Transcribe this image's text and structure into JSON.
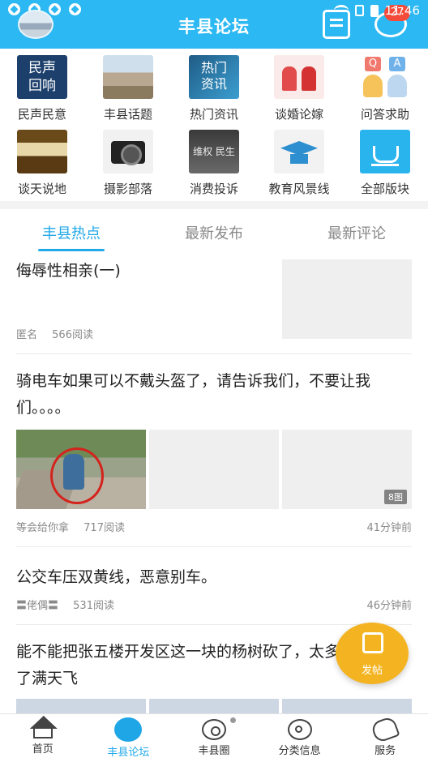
{
  "header": {
    "title": "丰县论坛",
    "time": "11:46",
    "message_badge": "27"
  },
  "categories": [
    {
      "label": "民声民意",
      "tile_text": "民声\n回响",
      "icon": "minsheng-icon"
    },
    {
      "label": "丰县话题",
      "icon": "fengxian-topic-icon"
    },
    {
      "label": "热门资讯",
      "tile_text": "热门\n资讯",
      "icon": "hot-news-icon"
    },
    {
      "label": "谈婚论嫁",
      "icon": "marriage-icon"
    },
    {
      "label": "问答求助",
      "icon": "qa-icon"
    },
    {
      "label": "谈天说地",
      "icon": "tea-icon"
    },
    {
      "label": "摄影部落",
      "icon": "camera-icon"
    },
    {
      "label": "消费投诉",
      "tile_text": "维权 民生",
      "icon": "complaint-icon"
    },
    {
      "label": "教育风景线",
      "icon": "education-icon"
    },
    {
      "label": "全部版块",
      "icon": "all-sections-icon"
    }
  ],
  "tabs": [
    {
      "label": "丰县热点",
      "active": true
    },
    {
      "label": "最新发布",
      "active": false
    },
    {
      "label": "最新评论",
      "active": false
    }
  ],
  "posts": [
    {
      "title": "侮辱性相亲(一)",
      "author": "匿名",
      "reads": "566阅读",
      "time": ""
    },
    {
      "title": "骑电车如果可以不戴头盔了，请告诉我们，不要让我们。。。。",
      "author": "等会给你拿",
      "reads": "717阅读",
      "time": "41分钟前",
      "image_count": "8图"
    },
    {
      "title": "公交车压双黄线，恶意别车。",
      "author": "〓佬偶〓",
      "reads": "531阅读",
      "time": "46分钟前"
    },
    {
      "title": "能不能把张五楼开发区这一块的杨树砍了，太多了满天飞"
    }
  ],
  "fab": {
    "label": "发帖"
  },
  "bottom_nav": [
    {
      "label": "首页",
      "icon": "home-icon",
      "active": false
    },
    {
      "label": "丰县论坛",
      "icon": "forum-icon",
      "active": true
    },
    {
      "label": "丰县圈",
      "icon": "circle-icon",
      "active": false
    },
    {
      "label": "分类信息",
      "icon": "classified-icon",
      "active": false
    },
    {
      "label": "服务",
      "icon": "service-icon",
      "active": false
    }
  ],
  "colors": {
    "header": "#2cb8f2",
    "accent": "#22a9e8",
    "fab": "#f4b421",
    "badge": "#f34a3a"
  }
}
